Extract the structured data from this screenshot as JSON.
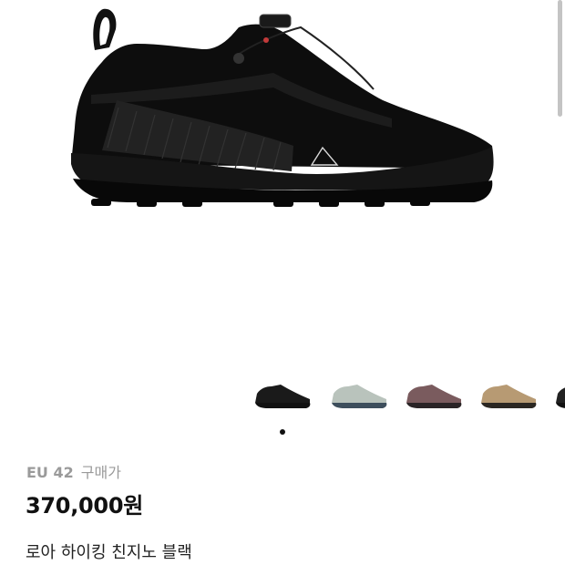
{
  "product": {
    "image_icon": "shoe-main-image",
    "size_label": "EU 42",
    "purchase_label": "구매가",
    "price": "370,000원",
    "name": "로아 하이킹 친지노 블랙"
  },
  "thumbnails": [
    {
      "icon": "shoe-thumbnail-black",
      "upper": "#1a1a1a",
      "sole": "#111111"
    },
    {
      "icon": "shoe-thumbnail-sage",
      "upper": "#b9c3bc",
      "sole": "#3d4e5c"
    },
    {
      "icon": "shoe-thumbnail-mauve",
      "upper": "#7a5b5e",
      "sole": "#2a2426"
    },
    {
      "icon": "shoe-thumbnail-tan",
      "upper": "#b79a73",
      "sole": "#2b2722"
    },
    {
      "icon": "shoe-thumbnail-partial",
      "upper": "#222222",
      "sole": "#111111"
    }
  ],
  "carousel": {
    "active_index": 0
  },
  "colors": {
    "price_text": "#111111",
    "muted_text": "#9a9a9a",
    "shoe_main": "#0d0d0d"
  }
}
